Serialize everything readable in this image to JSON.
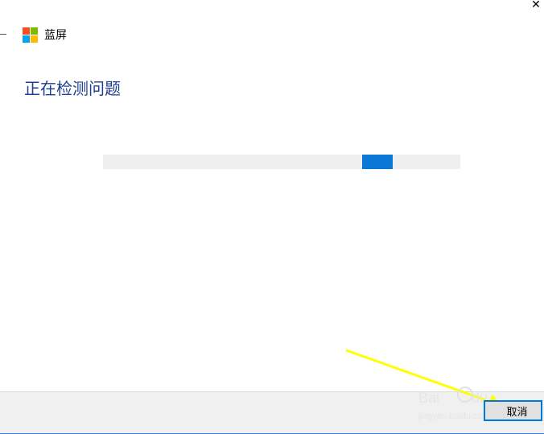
{
  "window": {
    "app_title": "蓝屏",
    "close_glyph": "✕"
  },
  "main": {
    "heading": "正在检测问题",
    "progress_chunk_start": 0.726,
    "progress_chunk_width": 0.086
  },
  "footer": {
    "cancel_label": "取消"
  },
  "watermark": {
    "text": "Baidu 经验",
    "url": "jingyan.baidu.com"
  },
  "colors": {
    "accent": "#0078d7",
    "heading": "#1f3f8f",
    "logo_red": "#f25022",
    "logo_green": "#7fba00",
    "logo_blue": "#00a4ef",
    "logo_yellow": "#ffb900",
    "annotation_arrow": "#ffff00"
  },
  "icons": {
    "logo": "microsoft-logo-icon",
    "close": "close-icon"
  }
}
